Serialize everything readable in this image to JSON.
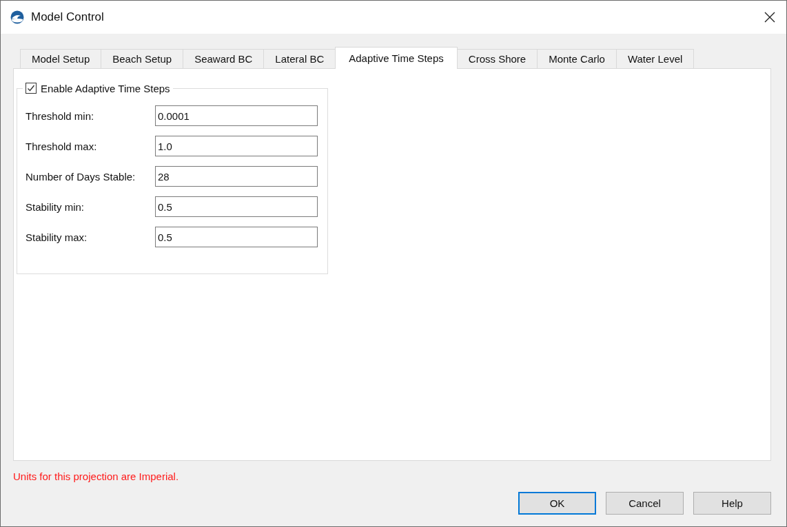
{
  "window": {
    "title": "Model Control"
  },
  "tabs": [
    {
      "label": "Model Setup",
      "selected": false
    },
    {
      "label": "Beach Setup",
      "selected": false
    },
    {
      "label": "Seaward BC",
      "selected": false
    },
    {
      "label": "Lateral BC",
      "selected": false
    },
    {
      "label": "Adaptive Time Steps",
      "selected": true
    },
    {
      "label": "Cross Shore",
      "selected": false
    },
    {
      "label": "Monte Carlo",
      "selected": false
    },
    {
      "label": "Water Level",
      "selected": false
    }
  ],
  "group": {
    "label": "Enable Adaptive Time Steps",
    "checked": true,
    "fields": [
      {
        "label": "Threshold min:",
        "value": "0.0001"
      },
      {
        "label": "Threshold max:",
        "value": "1.0"
      },
      {
        "label": "Number of Days Stable:",
        "value": "28"
      },
      {
        "label": "Stability min:",
        "value": "0.5"
      },
      {
        "label": "Stability max:",
        "value": "0.5"
      }
    ]
  },
  "message": "Units for this projection are Imperial.",
  "buttons": [
    {
      "label": "OK",
      "default": true
    },
    {
      "label": "Cancel",
      "default": false
    },
    {
      "label": "Help",
      "default": false
    }
  ]
}
